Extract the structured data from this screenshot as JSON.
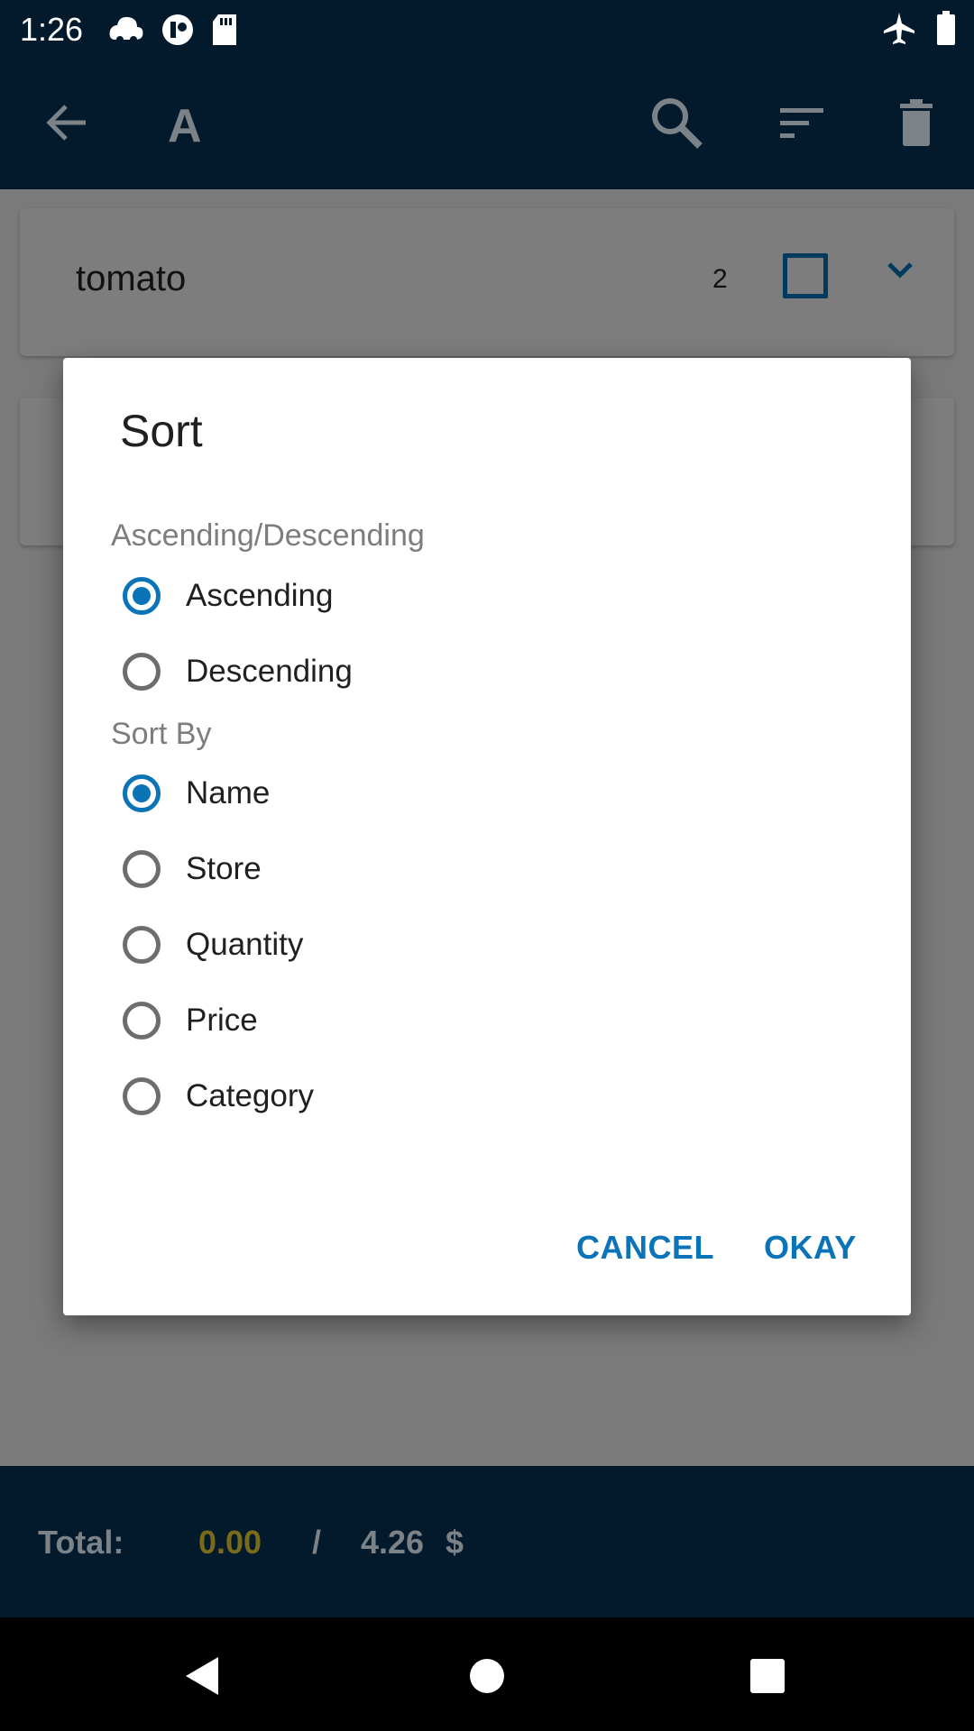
{
  "status_bar": {
    "time": "1:26",
    "left_icons": [
      "cloud-icon",
      "notification-icon",
      "sd-card-icon"
    ],
    "right_icons": [
      "airplane-icon",
      "battery-icon"
    ]
  },
  "toolbar": {
    "title": "A",
    "icons": [
      "back-arrow-icon",
      "search-icon",
      "sort-icon",
      "trash-icon"
    ]
  },
  "list": {
    "items": [
      {
        "name": "tomato",
        "quantity": "2",
        "checked": false
      }
    ]
  },
  "dialog": {
    "title": "Sort",
    "order_section_label": "Ascending/Descending",
    "order_options": [
      {
        "label": "Ascending",
        "selected": true
      },
      {
        "label": "Descending",
        "selected": false
      }
    ],
    "sort_by_section_label": "Sort By",
    "sort_by_options": [
      {
        "label": "Name",
        "selected": true
      },
      {
        "label": "Store",
        "selected": false
      },
      {
        "label": "Quantity",
        "selected": false
      },
      {
        "label": "Price",
        "selected": false
      },
      {
        "label": "Category",
        "selected": false
      }
    ],
    "cancel_label": "CANCEL",
    "okay_label": "OKAY"
  },
  "footer": {
    "total_label": "Total:",
    "checked_total": "0.00",
    "separator": "/",
    "overall_total": "4.26",
    "currency": "$"
  },
  "colors": {
    "accent": "#0b74b8",
    "appbar": "#021a2b",
    "checked_total": "#8a7a1e"
  }
}
